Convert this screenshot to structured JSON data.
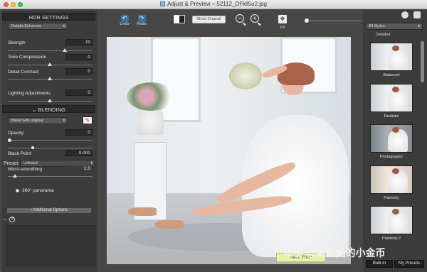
{
  "window": {
    "title": "Adjust & Preview – 52112_DFkll5u2.jpg"
  },
  "toolbar": {
    "undo_label": "Undo",
    "redo_label": "Redo",
    "show_original_label": "Show Original",
    "fit_label": "Fit"
  },
  "hdr_settings": {
    "title": "HDR SETTINGS",
    "preset_select": "Details Enhancer",
    "sliders": [
      {
        "label": "Strength",
        "value": "70",
        "fraction": 0.7
      },
      {
        "label": "Tone Compression",
        "value": "0",
        "fraction": 0.5
      },
      {
        "label": "Detail Contrast",
        "value": "0",
        "fraction": 0.5
      },
      {
        "label": "Lighting Adjustments",
        "value": "0",
        "fraction": 0.5
      }
    ]
  },
  "blending": {
    "title": "BLENDING",
    "mode_select": "Blend with original",
    "opacity_label": "Opacity",
    "opacity_value": "0",
    "black_point_label": "Black Point",
    "black_point_value": "0.000",
    "preset_label": "Preset:",
    "preset_value": "Unlisted",
    "micro_smoothing_label": "Micro-smoothing",
    "micro_smoothing_value": "2.0",
    "panorama_label": "360° panorama",
    "additional_options_label": "Additional Options",
    "help_symbol": "?"
  },
  "styles": {
    "select_value": "All Styles",
    "section_label": "Detailed",
    "items": [
      {
        "label": "Balanced"
      },
      {
        "label": "Realistic"
      },
      {
        "label": "Photographic"
      },
      {
        "label": "Painterly"
      },
      {
        "label": "Painterly 2"
      }
    ]
  },
  "footer": {
    "next_filter_label": "Next: Filter",
    "builtin_label": "Built-in",
    "my_presets_label": "My Presets"
  },
  "watermark": "知乎 @金灿灿的小金币",
  "colors": {
    "window_bg": "#474747",
    "panel_bg": "#3c3c3c",
    "accent": "#3d6ea8",
    "next_button": "#e8f2a2"
  }
}
